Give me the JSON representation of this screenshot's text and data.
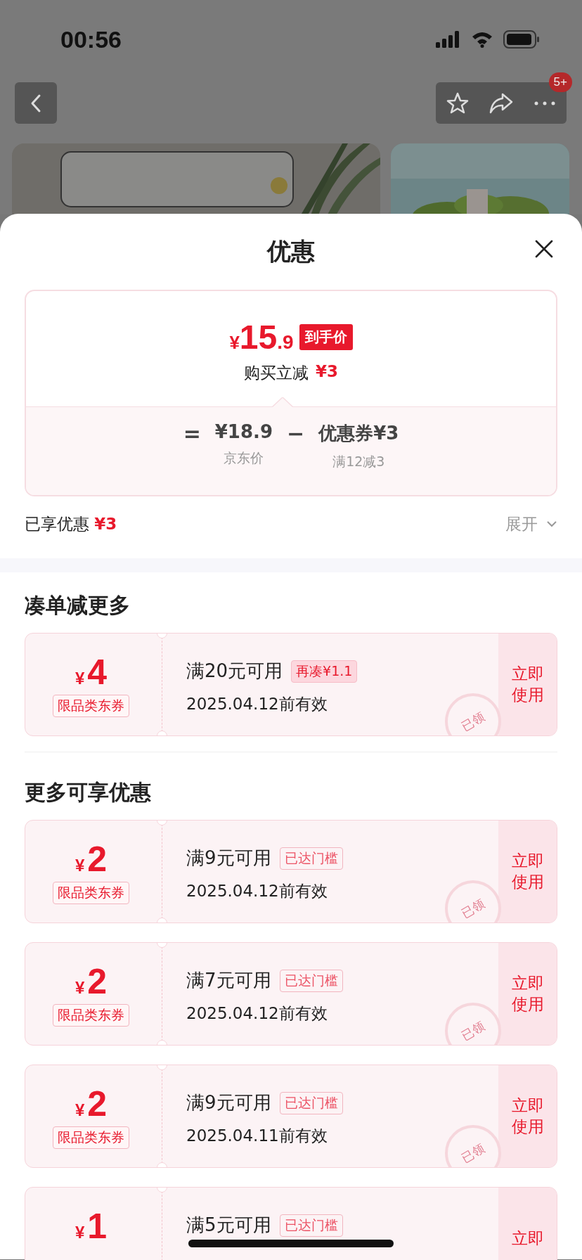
{
  "status_bar": {
    "time": "00:56"
  },
  "nav": {
    "badge": "5+"
  },
  "sheet": {
    "title": "优惠"
  },
  "price_card": {
    "currency": "¥",
    "price_int": "15",
    "price_dec": ".9",
    "price_tag": "到手价",
    "instant_label": "购买立减",
    "instant_amount": "¥3",
    "formula": {
      "equals": "=",
      "base_price": "¥18.9",
      "minus": "−",
      "coupon": "优惠券¥3",
      "base_label": "京东价",
      "coupon_label": "满12减3"
    }
  },
  "enjoyed": {
    "label": "已享优惠",
    "amount": "¥3",
    "expand": "展开"
  },
  "sections": [
    {
      "title": "凑单减更多",
      "coupons": [
        {
          "currency": "¥",
          "amount": "4",
          "scope": "限品类东券",
          "condition": "满20元可用",
          "tag": {
            "kind": "filled",
            "text": "再凑¥1.1"
          },
          "expiry": "2025.04.12前有效",
          "stamp": "已领",
          "action": "立即使用"
        }
      ]
    },
    {
      "title": "更多可享优惠",
      "coupons": [
        {
          "currency": "¥",
          "amount": "2",
          "scope": "限品类东券",
          "condition": "满9元可用",
          "tag": {
            "kind": "outline",
            "text": "已达门槛"
          },
          "expiry": "2025.04.12前有效",
          "stamp": "已领",
          "action": "立即使用"
        },
        {
          "currency": "¥",
          "amount": "2",
          "scope": "限品类东券",
          "condition": "满7元可用",
          "tag": {
            "kind": "outline",
            "text": "已达门槛"
          },
          "expiry": "2025.04.12前有效",
          "stamp": "已领",
          "action": "立即使用"
        },
        {
          "currency": "¥",
          "amount": "2",
          "scope": "限品类东券",
          "condition": "满9元可用",
          "tag": {
            "kind": "outline",
            "text": "已达门槛"
          },
          "expiry": "2025.04.11前有效",
          "stamp": "已领",
          "action": "立即使用"
        },
        {
          "currency": "¥",
          "amount": "1",
          "condition": "满5元可用",
          "tag": {
            "kind": "outline",
            "text": "已达门槛"
          },
          "action": "立即"
        }
      ]
    }
  ]
}
